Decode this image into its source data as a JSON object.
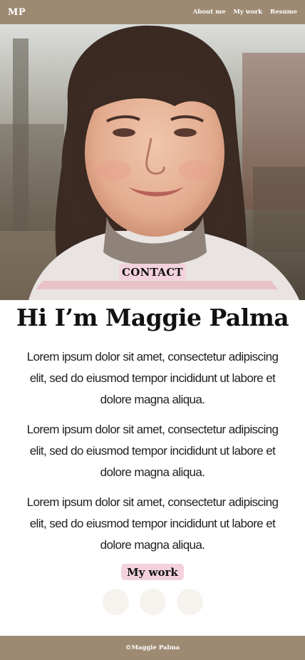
{
  "navbar": {
    "logo": "MP",
    "links": [
      "About me",
      "My work",
      "Resume"
    ]
  },
  "hero": {
    "contact_label": "CONTACT"
  },
  "main": {
    "headline": "Hi I’m Maggie Palma",
    "paragraphs": [
      "Lorem ipsum dolor sit amet, consectetur adipiscing elit, sed do eiusmod tempor incididunt ut labore et dolore magna aliqua.",
      "Lorem ipsum dolor sit amet, consectetur adipiscing elit, sed do eiusmod tempor incididunt ut labore et dolore magna aliqua.",
      "Lorem ipsum dolor sit amet, consectetur adipiscing elit, sed do eiusmod tempor incididunt ut labore et dolore magna aliqua."
    ],
    "work_label": "My work"
  },
  "footer": {
    "text": "©Maggie Palma"
  },
  "colors": {
    "nav_background": "#9e8a73",
    "button_pink": "#f3d2dc",
    "social_circle": "#f6f3ee"
  }
}
